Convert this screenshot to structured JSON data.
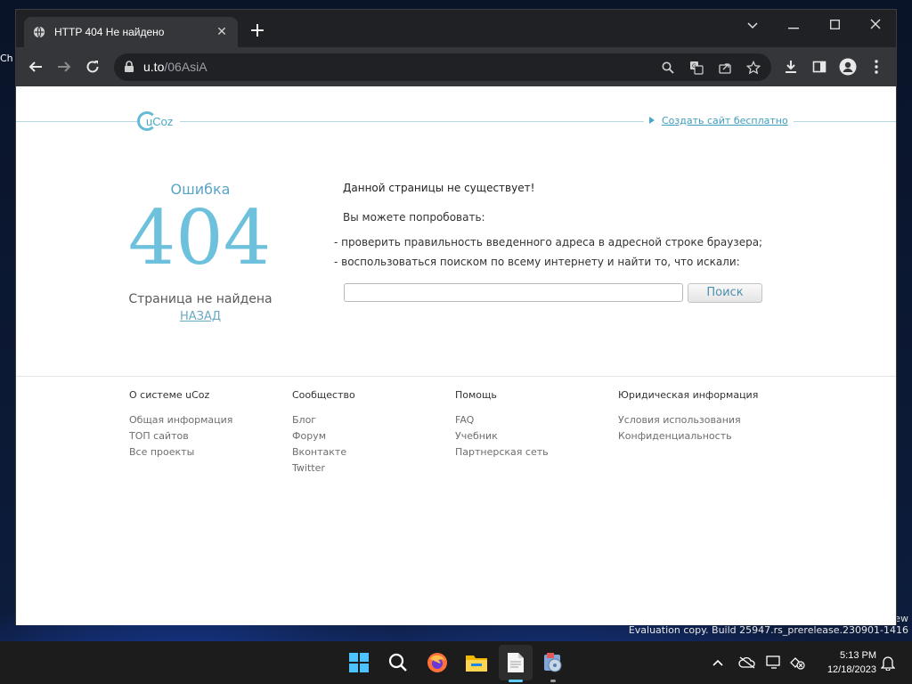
{
  "browser": {
    "tab_title": "HTTP 404 Не найдено",
    "url_host": "u.to",
    "url_path": "/06AsiA"
  },
  "page": {
    "create_site_link": "Создать сайт бесплатно",
    "error_word": "Ошибка",
    "error_code": "404",
    "not_found": "Страница не найдена",
    "back_link": "НАЗАД",
    "message_heading": "Данной страницы не существует!",
    "try_text": "Вы можете попробовать:",
    "suggestions": [
      "- проверить правильность введенного адреса в адресной строке браузера;",
      "- воспользоваться поиском по всему интернету и найти то, что искали:"
    ],
    "search_button": "Поиск",
    "search_value": ""
  },
  "footer": {
    "columns": [
      {
        "heading": "О системе uCoz",
        "items": [
          "Общая информация",
          "ТОП сайтов",
          "Все проекты"
        ]
      },
      {
        "heading": "Сообщество",
        "items": [
          "Блог",
          "Форум",
          "Вконтакте",
          "Twitter"
        ]
      },
      {
        "heading": "Помощь",
        "items": [
          "FAQ",
          "Учебник",
          "Партнерская сеть"
        ]
      },
      {
        "heading": "Юридическая информация",
        "items": [
          "Условия использования",
          "Конфиденциальность"
        ]
      }
    ]
  },
  "desktop": {
    "evaluation_text": "Evaluation copy. Build 25947.rs_prerelease.230901-1416",
    "right_fragment": "ew",
    "left_fragment": "Ch"
  },
  "taskbar": {
    "time": "5:13 PM",
    "date": "12/18/2023"
  },
  "colors": {
    "accent": "#6ec1dd",
    "link": "#3d9cbd",
    "taskbar_indicator": "#60cdff"
  }
}
